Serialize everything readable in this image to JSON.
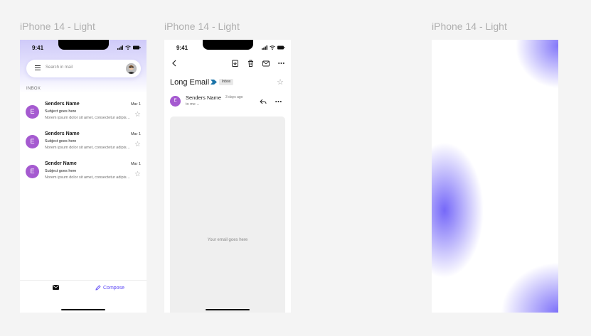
{
  "frames": [
    {
      "label": "iPhone 14 - Light"
    },
    {
      "label": "iPhone 14 - Light"
    },
    {
      "label": "iPhone 14 - Light"
    }
  ],
  "status": {
    "time": "9:41"
  },
  "inbox": {
    "search_placeholder": "Search in mail",
    "section_label": "INBOX",
    "emails": [
      {
        "avatar": "E",
        "sender": "Senders Name",
        "date": "Mar 1",
        "subject": "Subject goes here",
        "preview": "Norem ipsum dolor sit amet, consectetur adipiscing elit."
      },
      {
        "avatar": "E",
        "sender": "Senders Name",
        "date": "Mar 1",
        "subject": "Subject goes here",
        "preview": "Norem ipsum dolor sit amet, consectetur adipiscing elit."
      },
      {
        "avatar": "E",
        "sender": "Sender Name",
        "date": "Mar 1",
        "subject": "Subject goes here",
        "preview": "Norem ipsum dolor sit amet, consectetur adipiscing elit."
      }
    ],
    "compose_label": "Compose"
  },
  "detail": {
    "title": "Long Email",
    "chip": "Inbox",
    "sender_avatar": "E",
    "sender_name": "Senders Name",
    "sender_age": "3 days ago",
    "to_me": "to me",
    "body_placeholder": "Your email goes here"
  },
  "colors": {
    "accent": "#5b46f5",
    "avatar": "#a55ad0",
    "label_arrow": "#1a73a8"
  }
}
